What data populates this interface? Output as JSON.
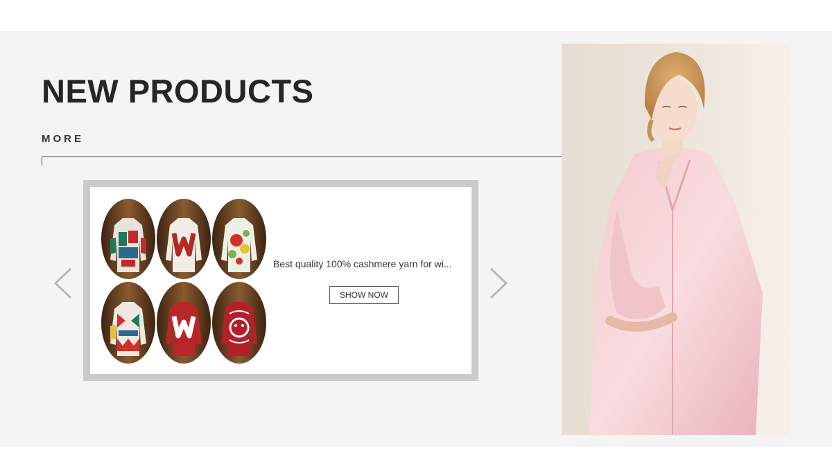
{
  "section": {
    "title": "NEW PRODUCTS",
    "more_label": "MORE"
  },
  "carousel": {
    "prev_icon": "chevron-left-icon",
    "next_icon": "chevron-right-icon",
    "slide": {
      "description": "Best quality 100% cashmere yarn for wi...",
      "button_label": "SHOW NOW",
      "image": "sweater-grid-image"
    }
  },
  "side_image": "pink-satin-pajama-model-image",
  "colors": {
    "title": "#262626",
    "section_bg": "#f4f4f4",
    "frame": "#c9cccc",
    "arrow": "#b8b8b8"
  }
}
